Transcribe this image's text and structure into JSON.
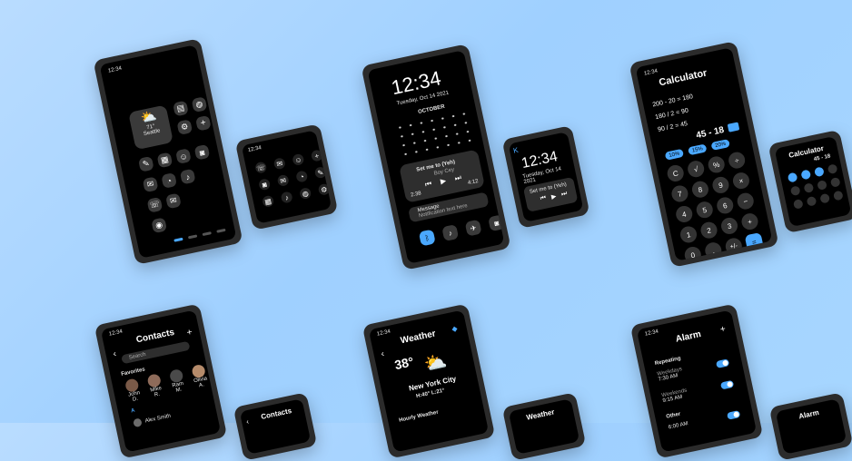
{
  "home": {
    "status_time": "12:34",
    "weather_temp": "71°",
    "weather_city": "Seattle",
    "dock_dots": [
      "",
      "",
      "",
      ""
    ],
    "app_icons": [
      "news-icon",
      "globe-icon",
      "gear-icon",
      "plus-icon",
      "notes-icon",
      "calendar-icon",
      "chat-icon",
      "camera-icon",
      "contacts-icon",
      "music-icon",
      "phone-icon",
      "clock-icon",
      "mail-icon",
      "photos-icon"
    ]
  },
  "lock": {
    "time_big": "12:34",
    "date_line": "Tuesday, Oct 14 2021",
    "month": "OCTOBER",
    "song_title": "Set me to (Yeh)",
    "song_artist": "Boy Cey",
    "time_left": "2:38",
    "time_right": "4:12",
    "notif_title": "Message",
    "notif_body": "Notification text here",
    "time_big_small": "12:34",
    "date_line_small": "Tuesday, Oct 14 2021",
    "song_title_small": "Set me to (Yeh)"
  },
  "calculator": {
    "status_time": "12:34",
    "title": "Calculator",
    "history": [
      "200 - 20 = 180",
      "180 / 2 = 90",
      "90 / 2 = 45"
    ],
    "current": "45 - 18",
    "small_title": "Calculator",
    "small_current": "45 - 18",
    "pct_buttons": [
      "10%",
      "15%",
      "20%"
    ],
    "keys": [
      "C",
      "√",
      "%",
      "÷",
      "7",
      "8",
      "9",
      "×",
      "4",
      "5",
      "6",
      "−",
      "1",
      "2",
      "3",
      "+",
      "0",
      ".",
      "+/-",
      "="
    ]
  },
  "contacts": {
    "status_time": "12:34",
    "title": "Contacts",
    "search_placeholder": "Search",
    "favorites_label": "Favorites",
    "favorites": [
      "John D.",
      "Mike R.",
      "Ram M.",
      "Olivia A."
    ],
    "section_letter": "A",
    "first_contact": "Alex Smith",
    "small_title": "Contacts"
  },
  "weather": {
    "status_time": "12:34",
    "title": "Weather",
    "temp": "38°",
    "city": "New York City",
    "hilo": "H:40°  L:21°",
    "hourly_label": "Hourly Weather",
    "small_title": "Weather"
  },
  "alarm": {
    "status_time": "12:34",
    "title": "Alarm",
    "repeating_label": "Repeating",
    "rows": [
      {
        "label": "Weekdays",
        "time": "7:30 AM"
      },
      {
        "label": "Weekends",
        "time": "9:15 AM"
      }
    ],
    "other_label": "Other",
    "other_time": "6:00 AM",
    "small_title": "Alarm"
  }
}
